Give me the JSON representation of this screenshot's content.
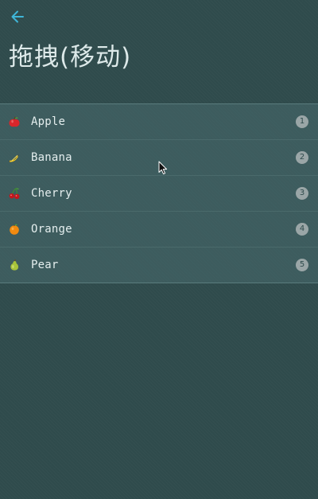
{
  "page": {
    "title": "拖拽(移动)",
    "accent_color": "#3fb6d8",
    "background_color": "#2f4b4c"
  },
  "back": {
    "icon": "arrow-left-icon"
  },
  "list": {
    "items": [
      {
        "label": "Apple",
        "icon": "apple-icon",
        "count": "1"
      },
      {
        "label": "Banana",
        "icon": "banana-icon",
        "count": "2"
      },
      {
        "label": "Cherry",
        "icon": "cherry-icon",
        "count": "3"
      },
      {
        "label": "Orange",
        "icon": "orange-icon",
        "count": "4"
      },
      {
        "label": "Pear",
        "icon": "pear-icon",
        "count": "5"
      }
    ]
  },
  "pointer": {
    "icon": "mouse-cursor-icon"
  }
}
